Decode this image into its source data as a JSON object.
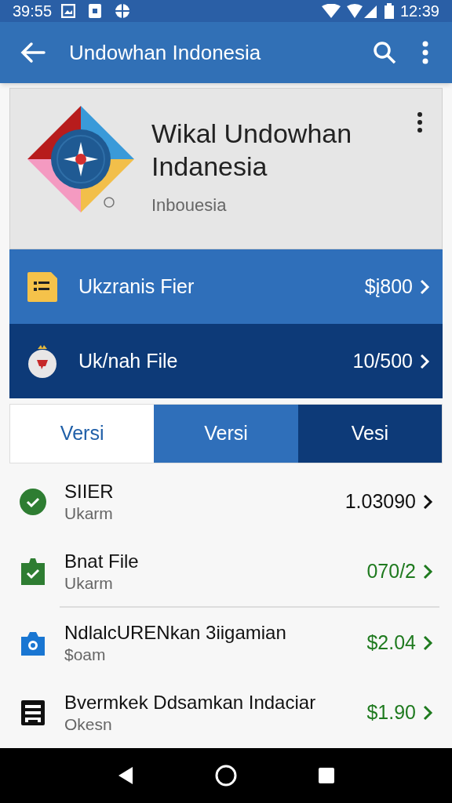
{
  "status_bar": {
    "left_time": "39:55",
    "time": "12:39"
  },
  "app_bar": {
    "title": "Undowhan Indonesia"
  },
  "header_card": {
    "title": "Wikal Undowhan Indanesia",
    "subtitle": "Inbouesia"
  },
  "promo_rows": [
    {
      "kind": "list",
      "label": "Ukzranis Fier",
      "value": "$į800",
      "color": "#2f6fba"
    },
    {
      "kind": "badge",
      "label": "Uk/nah File",
      "value": "10/500",
      "color": "#0d3a78"
    }
  ],
  "tabs": [
    {
      "label": "Versi",
      "selected": true
    },
    {
      "label": "Versi",
      "selected": false
    },
    {
      "label": "Vesi",
      "selected": false
    }
  ],
  "items": [
    {
      "kind": "check",
      "title": "SIIER",
      "subtitle": "Ukarm",
      "value": "1.03090",
      "color": "#111111"
    },
    {
      "kind": "clipboard",
      "title": "Bnat File",
      "subtitle": "Ukarm",
      "value": "070/2",
      "color": "#1f7a1f"
    },
    {
      "kind": "camera",
      "title": "NdlalcURENkan 3iigamian",
      "subtitle": "$oam",
      "value": "$2.04",
      "color": "#1f7a1f"
    },
    {
      "kind": "receipt",
      "title": "Bvermkek Ddsamkan Indaciar",
      "subtitle": "Okesn",
      "value": "$1.90",
      "color": "#1f7a1f"
    }
  ]
}
